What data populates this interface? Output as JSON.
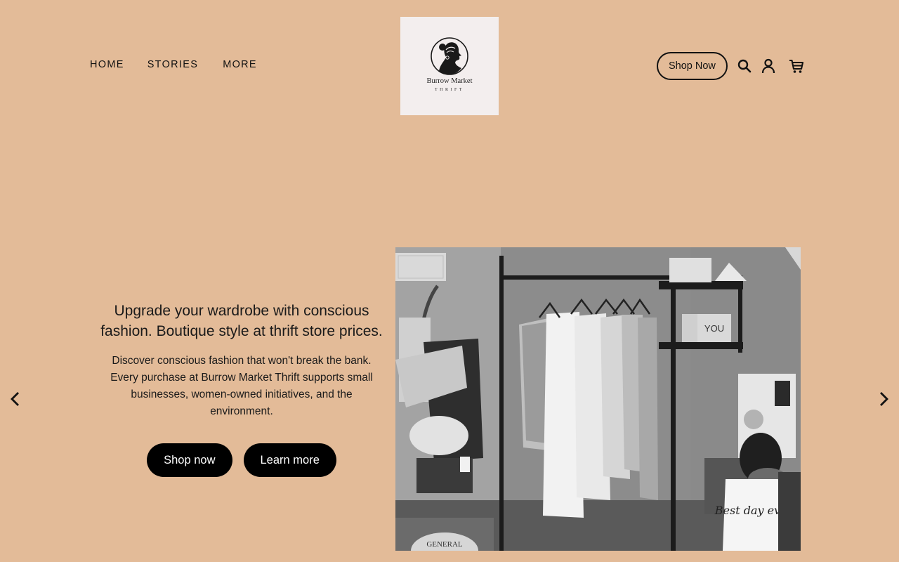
{
  "nav": {
    "items": [
      {
        "label": "HOME"
      },
      {
        "label": "STORIES"
      },
      {
        "label": "MORE"
      }
    ]
  },
  "logo": {
    "name": "Burrow Market",
    "sub": "THRIFT"
  },
  "header": {
    "shop_label": "Shop Now",
    "icons": [
      "search-icon",
      "user-icon",
      "cart-icon"
    ]
  },
  "hero": {
    "title": "Upgrade your wardrobe with conscious fashion. Boutique style at thrift store prices.",
    "body": "Discover conscious fashion that won't break the bank. Every purchase at Burrow Market Thrift supports small businesses, women-owned initiatives, and the environment.",
    "primary_button": "Shop now",
    "secondary_button": "Learn more",
    "image_sign_text": "GENERAL",
    "image_card_text": "YOU",
    "image_bag_text": "Best day ever"
  },
  "colors": {
    "background": "#e3bb98",
    "button": "#000000",
    "logo_bg": "#f3eeee"
  }
}
